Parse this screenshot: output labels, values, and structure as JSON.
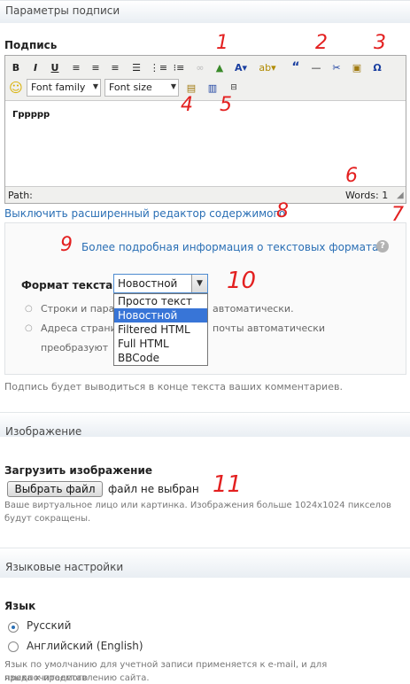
{
  "signature_section": {
    "heading": "Параметры подписи",
    "field_label": "Подпись",
    "editor": {
      "toolbar_row1": [
        "B",
        "I",
        "U"
      ],
      "font_family": "Font family",
      "font_size": "Font size",
      "content": "Грpppp",
      "path_label": "Path:",
      "words_label": "Words: 1"
    },
    "disable_editor_link": "Выключить расширенный редактор содержимого",
    "more_info_link": "Более подробная информация о текстовых форматах",
    "format_label": "Формат текста",
    "format_selected": "Новостной",
    "format_options": [
      "Просто текст",
      "Новостной",
      "Filtered HTML",
      "Full HTML",
      "BBCode"
    ],
    "format_tips": [
      "Строки и параграфы переносятся автоматически.",
      "Адреса страниц и электронной почты автоматически",
      "преобразуются в ссылки."
    ],
    "tip1_visible": "Строки и пара",
    "tip1_end": "автоматически.",
    "tip2_start": "Адреса страни",
    "tip2_end": "почты автоматически",
    "tip3_start": "преобразуют",
    "description": "Подпись будет выводиться в конце текста ваших комментариев."
  },
  "image_section": {
    "heading": "Изображение",
    "upload_label": "Загрузить изображение",
    "choose_file_button": "Выбрать файл",
    "no_file_text": "файл не выбран",
    "description_line1": "Ваше виртуальное лицо или картинка. Изображения больше 1024x1024 пикселов",
    "description_line2": "будут сокращены."
  },
  "language_section": {
    "heading": "Языковые настройки",
    "field_label": "Язык",
    "options": [
      "Русский",
      "Английский (English)"
    ],
    "selected_index": 0,
    "description_line1": "Язык по умолчанию для учетной записи применяется к e-mail, и для предпочитаемого",
    "description_line2": "языка к представлению сайта."
  },
  "annotations": [
    "1",
    "2",
    "3",
    "4",
    "5",
    "6",
    "7",
    "8",
    "9",
    "10",
    "11"
  ],
  "colors": {
    "link": "#2a6fb5",
    "annotation": "#e32020",
    "selection": "#3875d7"
  }
}
